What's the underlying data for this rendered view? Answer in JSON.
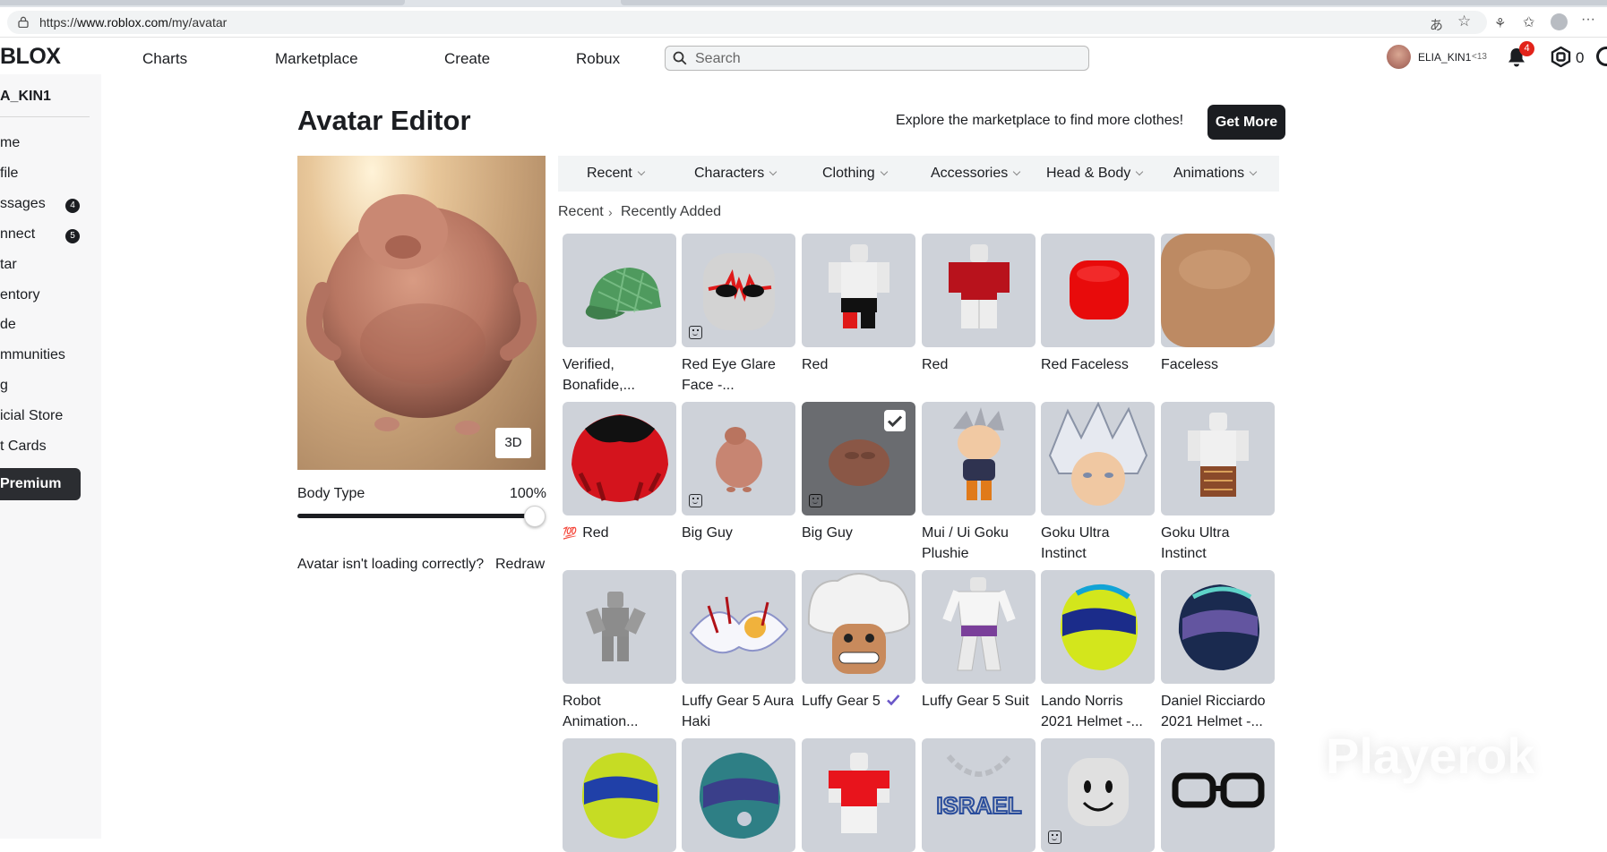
{
  "browser": {
    "url_prefix": "https://",
    "url_domain": "www.roblox.com",
    "url_path": "/my/avatar"
  },
  "header": {
    "logo": "BLOX",
    "nav": [
      "Charts",
      "Marketplace",
      "Create",
      "Robux"
    ],
    "search_placeholder": "Search",
    "username": "ELIA_KIN1",
    "age": "<13",
    "notifications": "4",
    "robux": "0"
  },
  "sidebar": {
    "username": "A_KIN1",
    "items": [
      "me",
      "file",
      "ssages",
      "nnect",
      "tar",
      "entory",
      "de",
      "mmunities",
      "g",
      "icial Store",
      "t Cards"
    ],
    "messages_badge": "4",
    "connect_badge": "5",
    "premium": "Premium"
  },
  "main": {
    "title": "Avatar Editor",
    "explore_text": "Explore the marketplace to find more clothes!",
    "get_more": "Get More",
    "view_3d": "3D",
    "body_type_label": "Body Type",
    "body_type_value": "100%",
    "body_type_level": 1.0,
    "redraw_question": "Avatar isn't loading correctly?",
    "redraw": "Redraw",
    "categories": [
      "Recent",
      "Characters",
      "Clothing",
      "Accessories",
      "Head & Body",
      "Animations"
    ],
    "breadcrumb": [
      "Recent",
      "Recently Added"
    ],
    "items": [
      {
        "name": "Verified, Bonafide,...",
        "icon": "plaid-cap-icon"
      },
      {
        "name": "Red Eye Glare Face -...",
        "icon": "red-eye-glare-face-icon"
      },
      {
        "name": "Red",
        "icon": "red-outfit-icon"
      },
      {
        "name": "Red",
        "icon": "red-shirt-outfit-icon"
      },
      {
        "name": "Red Faceless",
        "icon": "red-head-icon"
      },
      {
        "name": "Faceless",
        "icon": "tan-head-icon"
      },
      {
        "name": "Red",
        "icon": "red-black-hair-icon",
        "tag": "💯"
      },
      {
        "name": "Big Guy",
        "icon": "big-guy-body-icon"
      },
      {
        "name": "Big Guy",
        "icon": "big-guy-head-icon"
      },
      {
        "name": "Mui / Ui Goku Plushie",
        "icon": "goku-plushie-icon"
      },
      {
        "name": "Goku Ultra Instinct",
        "icon": "goku-hair-icon"
      },
      {
        "name": "Goku Ultra Instinct",
        "icon": "goku-outfit-icon"
      },
      {
        "name": "Robot Animation...",
        "icon": "robot-animation-icon"
      },
      {
        "name": "Luffy Gear 5 Aura Haki",
        "icon": "aura-haki-icon"
      },
      {
        "name": "Luffy Gear 5",
        "icon": "luffy-head-icon"
      },
      {
        "name": "Luffy Gear 5 Suit",
        "icon": "luffy-suit-icon"
      },
      {
        "name": "Lando Norris 2021 Helmet -...",
        "icon": "lando-helmet-icon"
      },
      {
        "name": "Daniel Ricciardo 2021 Helmet -...",
        "icon": "ricciardo-helmet-icon"
      },
      {
        "name": "",
        "icon": "yellow-helmet-icon"
      },
      {
        "name": "",
        "icon": "teal-helmet-icon"
      },
      {
        "name": "",
        "icon": "red-tshirt-outfit-icon"
      },
      {
        "name": "",
        "icon": "israel-chain-icon",
        "text": "ISRAEL"
      },
      {
        "name": "",
        "icon": "smile-head-icon"
      },
      {
        "name": "",
        "icon": "black-glasses-icon"
      }
    ]
  },
  "watermark": "Playerok"
}
